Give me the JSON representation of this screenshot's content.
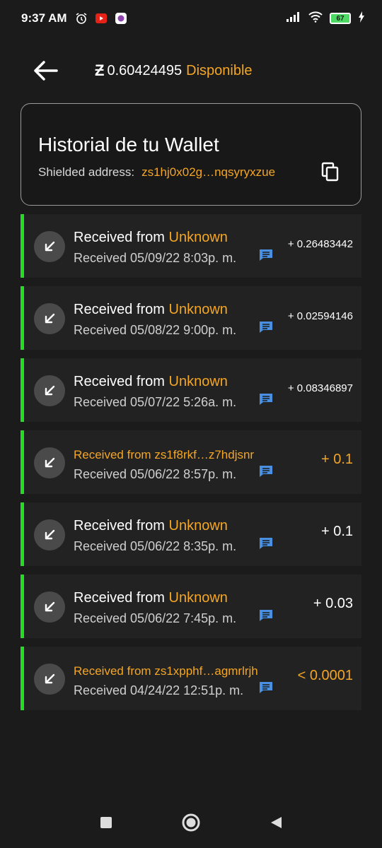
{
  "status_bar": {
    "time": "9:37 AM",
    "battery": "67",
    "icons": [
      "alarm-icon",
      "youtube-icon",
      "app-icon",
      "signal-icon",
      "wifi-icon",
      "battery-icon",
      "charging-icon"
    ]
  },
  "header": {
    "currency_symbol": "Ƶ",
    "balance": "0.60424495",
    "balance_label": "Disponible",
    "back_icon": "back-arrow-icon"
  },
  "wallet": {
    "title": "Historial de tu Wallet",
    "address_label": "Shielded address:",
    "address": "zs1hj0x02g…nqsyryxzue",
    "copy_icon": "copy-icon"
  },
  "colors": {
    "accent": "#f5a623",
    "received_bar": "#22dd22",
    "memo": "#4a90e2",
    "background": "#1b1b1b",
    "card": "#222222"
  },
  "transactions": [
    {
      "prefix": "Received from ",
      "from": "Unknown",
      "date": "Received 05/09/22 8:03p. m.",
      "amount": "+ 0.26483442"
    },
    {
      "prefix": "Received from ",
      "from": "Unknown",
      "date": "Received 05/08/22 9:00p. m.",
      "amount": "+ 0.02594146"
    },
    {
      "prefix": "Received from ",
      "from": "Unknown",
      "date": "Received 05/07/22 5:26a. m.",
      "amount": "+ 0.08346897"
    },
    {
      "title": "Received from zs1f8rkf…z7hdjsnr",
      "date": "Received 05/06/22 8:57p. m.",
      "amount": "+ 0.1"
    },
    {
      "prefix": "Received from ",
      "from": "Unknown",
      "date": "Received 05/06/22 8:35p. m.",
      "amount": "+ 0.1"
    },
    {
      "prefix": "Received from ",
      "from": "Unknown",
      "date": "Received 05/06/22 7:45p. m.",
      "amount": "+ 0.03"
    },
    {
      "title": "Received from zs1xpphf…agmrlrjh",
      "date": "Received 04/24/22 12:51p. m.",
      "amount": "< 0.0001"
    }
  ],
  "nav": [
    "recents-icon",
    "home-icon",
    "back-icon"
  ]
}
